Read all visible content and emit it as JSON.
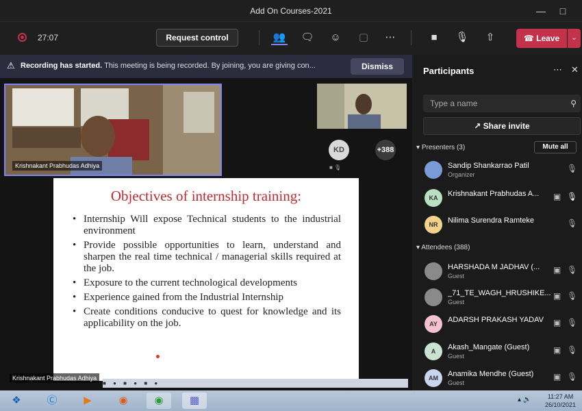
{
  "window": {
    "title": "Add On Courses-2021"
  },
  "toolbar": {
    "timer": "27:07",
    "request_control": "Request control",
    "leave": "Leave"
  },
  "banner": {
    "bold": "Recording has started.",
    "text": "This meeting is being recorded. By joining, you are giving con...",
    "dismiss": "Dismiss"
  },
  "stage": {
    "main_video_name": "Krishnakant Prabhudas Adhiya",
    "kd_initials": "KD",
    "overflow_count": "+388",
    "presenter_name": "Krishnakant Prabhudas Adhiya"
  },
  "slide": {
    "title": "Objectives of internship training:",
    "bullets": [
      "Internship Will expose Technical students to the industrial environment",
      "Provide possible opportunities to learn, understand and sharpen the real time technical / managerial skills required at the job.",
      "Exposure to the current technological developments",
      "Experience gained from the Industrial Internship",
      "Create conditions conducive to quest for knowledge and its applicability on the job."
    ]
  },
  "panel": {
    "title": "Participants",
    "search_placeholder": "Type a name",
    "share_invite": "Share invite",
    "presenters_label": "Presenters (3)",
    "mute_all": "Mute all",
    "attendees_label": "Attendees (388)",
    "presenters": [
      {
        "initials": "",
        "name": "Sandip Shankarrao Patil",
        "role": "Organizer",
        "color": "#7a9bd8"
      },
      {
        "initials": "KA",
        "name": "Krishnakant Prabhudas A...",
        "role": "",
        "color": "#b9e0c0"
      },
      {
        "initials": "NR",
        "name": "Nilima Surendra Ramteke",
        "role": "",
        "color": "#f2d28a"
      }
    ],
    "attendees": [
      {
        "initials": "",
        "name": "HARSHADA M JADHAV (...",
        "role": "Guest",
        "color": "#8a8a8a"
      },
      {
        "initials": "",
        "name": "_71_TE_WAGH_HRUSHIKE...",
        "role": "Guest",
        "color": "#8a8a8a"
      },
      {
        "initials": "AY",
        "name": "ADARSH PRAKASH YADAV",
        "role": "",
        "color": "#f3c1d0"
      },
      {
        "initials": "A",
        "name": "Akash_Mangate (Guest)",
        "role": "Guest",
        "color": "#c9e3d0"
      },
      {
        "initials": "AM",
        "name": "Anamika Mendhe (Guest)",
        "role": "Guest",
        "color": "#c8d4f0"
      }
    ]
  },
  "taskbar": {
    "time": "11:27 AM",
    "date": "26/10/2021"
  },
  "colors": {
    "accent": "#7f85f5",
    "leave": "#c4314b",
    "slide_title": "#c0282d"
  }
}
